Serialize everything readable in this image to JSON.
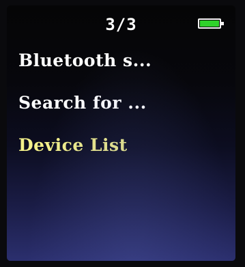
{
  "status_bar": {
    "page_indicator": "3/3",
    "battery_level": 1.0,
    "battery_color": "#2fd22a"
  },
  "menu": {
    "items": [
      {
        "label": "Bluetooth s...",
        "selected": false
      },
      {
        "label": "Search for ...",
        "selected": false
      },
      {
        "label": "Device List",
        "selected": true
      }
    ],
    "selected_color": "#f3f08a",
    "text_color": "#ffffff"
  }
}
